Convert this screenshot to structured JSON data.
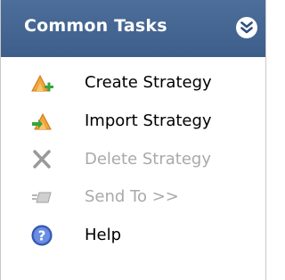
{
  "panel": {
    "title": "Common Tasks",
    "collapse_icon": "double-chevron-up-icon",
    "header_color": "#44658f"
  },
  "tasks": [
    {
      "label": "Create Strategy",
      "icon": "create-strategy-icon",
      "enabled": true
    },
    {
      "label": "Import Strategy",
      "icon": "import-strategy-icon",
      "enabled": true
    },
    {
      "label": "Delete Strategy",
      "icon": "delete-x-icon",
      "enabled": false
    },
    {
      "label": "Send To >>",
      "icon": "send-to-icon",
      "enabled": false
    },
    {
      "label": "Help",
      "icon": "help-icon",
      "enabled": true
    }
  ],
  "colors": {
    "disabled_text": "#a9a9a9",
    "enabled_text": "#000000"
  }
}
